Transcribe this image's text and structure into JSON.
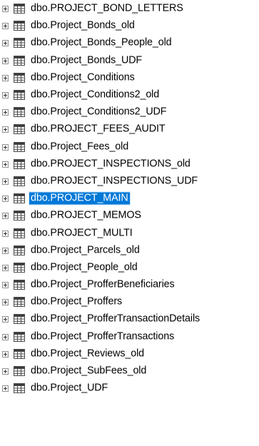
{
  "tree": {
    "items": [
      {
        "label": "dbo.PROJECT_BOND_LETTERS",
        "selected": false
      },
      {
        "label": "dbo.Project_Bonds_old",
        "selected": false
      },
      {
        "label": "dbo.Project_Bonds_People_old",
        "selected": false
      },
      {
        "label": "dbo.Project_Bonds_UDF",
        "selected": false
      },
      {
        "label": "dbo.Project_Conditions",
        "selected": false
      },
      {
        "label": "dbo.Project_Conditions2_old",
        "selected": false
      },
      {
        "label": "dbo.Project_Conditions2_UDF",
        "selected": false
      },
      {
        "label": "dbo.PROJECT_FEES_AUDIT",
        "selected": false
      },
      {
        "label": "dbo.Project_Fees_old",
        "selected": false
      },
      {
        "label": "dbo.PROJECT_INSPECTIONS_old",
        "selected": false
      },
      {
        "label": "dbo.PROJECT_INSPECTIONS_UDF",
        "selected": false
      },
      {
        "label": "dbo.PROJECT_MAIN",
        "selected": true
      },
      {
        "label": "dbo.PROJECT_MEMOS",
        "selected": false
      },
      {
        "label": "dbo.PROJECT_MULTI",
        "selected": false
      },
      {
        "label": "dbo.Project_Parcels_old",
        "selected": false
      },
      {
        "label": "dbo.Project_People_old",
        "selected": false
      },
      {
        "label": "dbo.Project_ProfferBeneficiaries",
        "selected": false
      },
      {
        "label": "dbo.Project_Proffers",
        "selected": false
      },
      {
        "label": "dbo.Project_ProfferTransactionDetails",
        "selected": false
      },
      {
        "label": "dbo.Project_ProfferTransactions",
        "selected": false
      },
      {
        "label": "dbo.Project_Reviews_old",
        "selected": false
      },
      {
        "label": "dbo.Project_SubFees_old",
        "selected": false
      },
      {
        "label": "dbo.Project_UDF",
        "selected": false
      }
    ],
    "icons": {
      "expander": "expand-plus-icon",
      "node": "table-icon"
    },
    "colors": {
      "selection_background": "#0078d7",
      "selection_text": "#ffffff",
      "table_icon_frame": "#4a4a4a",
      "table_icon_header": "#3c3c3c"
    }
  }
}
